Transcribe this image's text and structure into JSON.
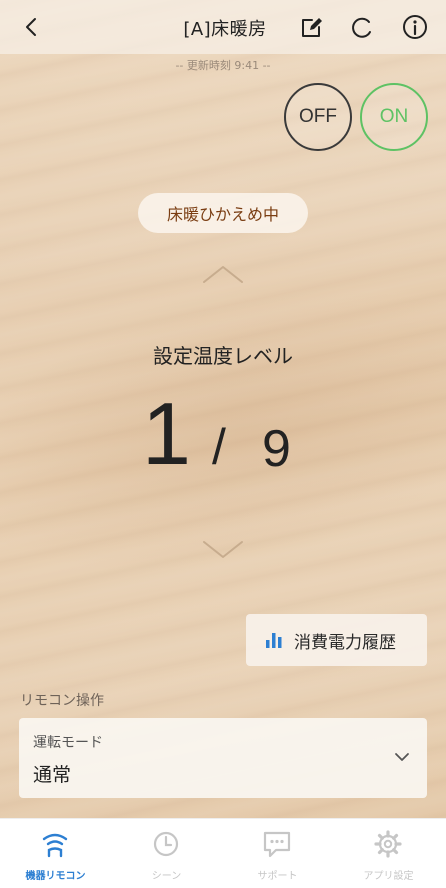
{
  "header": {
    "title": "[A]床暖房",
    "updated": "-- 更新時刻 9:41 --"
  },
  "power": {
    "off_label": "OFF",
    "on_label": "ON",
    "on_color": "#5ec264"
  },
  "status": {
    "text": "床暖ひかえめ中",
    "color": "#7a3d12"
  },
  "level": {
    "label": "設定温度レベル",
    "current": "1",
    "separator": "/",
    "max": "9"
  },
  "history_button": {
    "label": "消費電力履歴",
    "icon": "bar-chart-icon",
    "icon_color": "#2d7fd2"
  },
  "remote_section": {
    "label": "リモコン操作",
    "mode": {
      "label": "運転モード",
      "value": "通常"
    }
  },
  "tabs": [
    {
      "label": "機器リモコン",
      "icon": "wifi-icon",
      "active": true
    },
    {
      "label": "シーン",
      "icon": "clock-icon",
      "active": false
    },
    {
      "label": "サポート",
      "icon": "chat-icon",
      "active": false
    },
    {
      "label": "アプリ設定",
      "icon": "gear-icon",
      "active": false
    }
  ],
  "colors": {
    "accent": "#2d7fd2",
    "inactive_tab": "#c6c6c6"
  }
}
